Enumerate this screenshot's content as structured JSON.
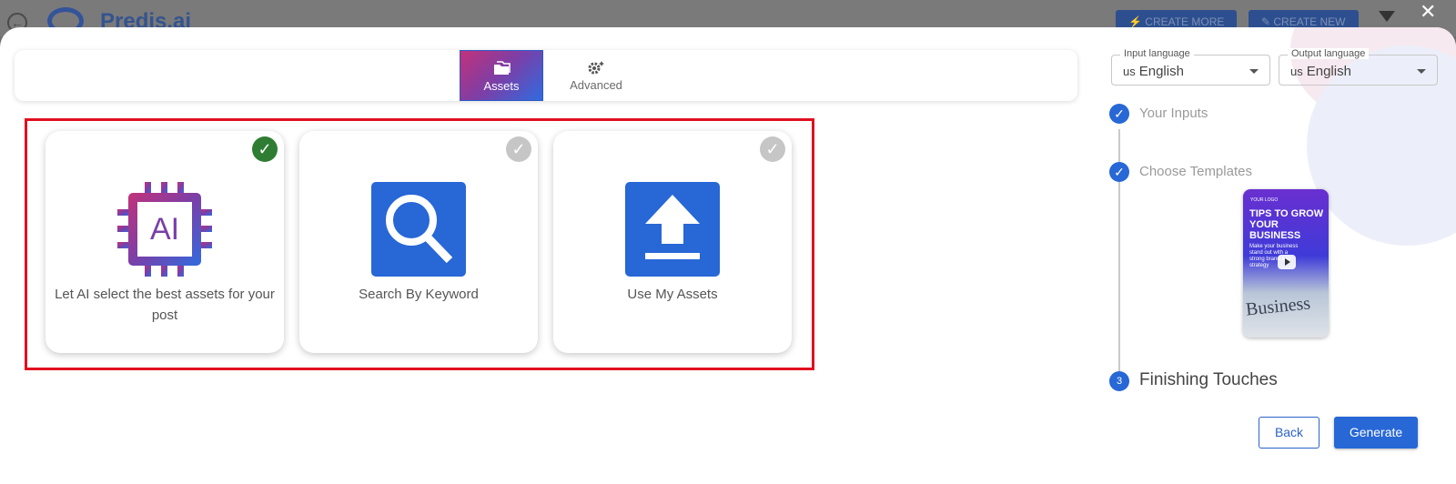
{
  "background_app": {
    "brand": "Predis.ai",
    "create_more_label": "CREATE MORE",
    "create_new_label": "CREATE NEW"
  },
  "tabs": [
    {
      "label": "Assets",
      "icon": "folder-icon",
      "active": true
    },
    {
      "label": "Advanced",
      "icon": "settings-sparkle-icon",
      "active": false
    }
  ],
  "asset_options": [
    {
      "label": "Let AI select the best assets for your post",
      "icon": "ai-chip-icon",
      "selected": true
    },
    {
      "label": "Search By Keyword",
      "icon": "search-icon",
      "selected": false
    },
    {
      "label": "Use My Assets",
      "icon": "upload-icon",
      "selected": false
    }
  ],
  "input_language": {
    "legend": "Input language",
    "country": "us",
    "value": "English"
  },
  "output_language": {
    "legend": "Output language",
    "country": "us",
    "value": "English"
  },
  "steps": [
    {
      "label": "Your Inputs",
      "status": "done"
    },
    {
      "label": "Choose Templates",
      "status": "done"
    },
    {
      "number": "3",
      "label": "Finishing Touches",
      "status": "current"
    }
  ],
  "template_preview": {
    "small": "YOUR LOGO",
    "headline": "TIPS TO GROW YOUR BUSINESS",
    "subtext": "Make your business stand out with a strong brand and strategy",
    "word": "Business"
  },
  "actions": {
    "back_label": "Back",
    "generate_label": "Generate"
  },
  "colors": {
    "accent": "#2767d6",
    "selected_check": "#2e7d32",
    "highlight": "#e0101f"
  }
}
